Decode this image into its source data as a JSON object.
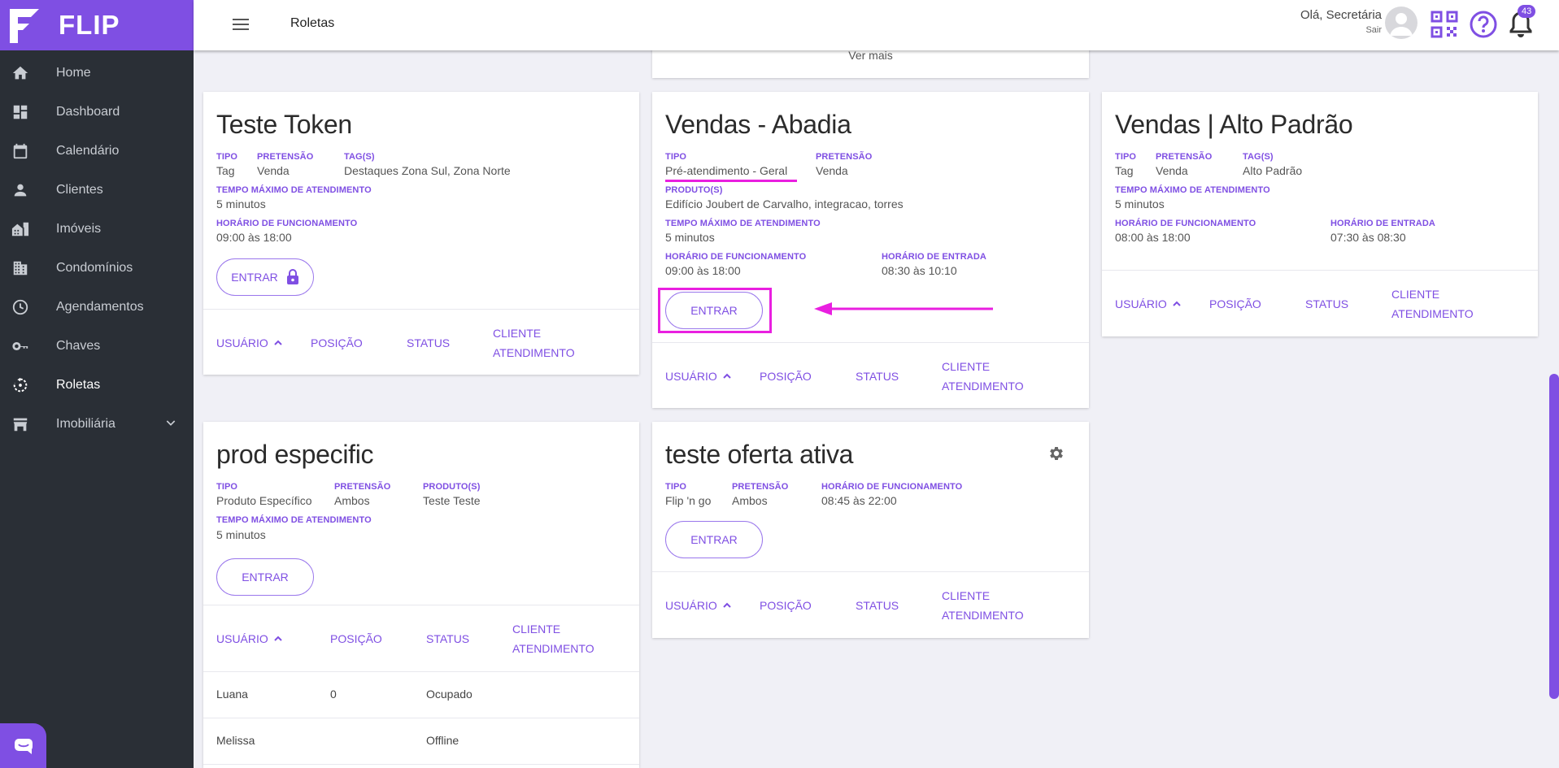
{
  "app": {
    "brand": "FLIP",
    "page_title": "Roletas"
  },
  "user": {
    "greeting": "Olá, Secretária",
    "logout": "Sair",
    "notifications": "43"
  },
  "sidebar": {
    "items": [
      {
        "label": "Home",
        "icon": "home-icon"
      },
      {
        "label": "Dashboard",
        "icon": "dashboard-icon"
      },
      {
        "label": "Calendário",
        "icon": "calendar-icon"
      },
      {
        "label": "Clientes",
        "icon": "person-icon"
      },
      {
        "label": "Imóveis",
        "icon": "building-icon"
      },
      {
        "label": "Condomínios",
        "icon": "apartment-icon"
      },
      {
        "label": "Agendamentos",
        "icon": "clock-icon"
      },
      {
        "label": "Chaves",
        "icon": "key-icon"
      },
      {
        "label": "Roletas",
        "icon": "roulette-icon",
        "active": true
      },
      {
        "label": "Imobiliária",
        "icon": "store-icon",
        "expandable": true
      }
    ]
  },
  "top_card": {
    "see_more": "Ver mais"
  },
  "labels": {
    "tipo": "TIPO",
    "pretensao": "PRETENSÃO",
    "tags": "TAG(S)",
    "produtos": "PRODUTO(S)",
    "tempo": "TEMPO MÁXIMO DE ATENDIMENTO",
    "horario_func": "HORÁRIO DE FUNCIONAMENTO",
    "horario_entrada": "HORÁRIO DE ENTRADA",
    "entrar": "ENTRAR",
    "col_usuario": "USUÁRIO",
    "col_posicao": "POSIÇÃO",
    "col_status": "STATUS",
    "col_cliente_1": "CLIENTE",
    "col_cliente_2": "ATENDIMENTO"
  },
  "cards": {
    "teste_token": {
      "title": "Teste Token",
      "tipo": "Tag",
      "pretensao": "Venda",
      "tags": "Destaques Zona Sul, Zona Norte",
      "tempo": "5 minutos",
      "horario_func": "09:00 às 18:00"
    },
    "vendas_abadia": {
      "title": "Vendas - Abadia",
      "tipo": "Pré-atendimento - Geral",
      "pretensao": "Venda",
      "produtos": "Edifício Joubert de Carvalho, integracao, torres",
      "tempo": "5 minutos",
      "horario_func": "09:00 às 18:00",
      "horario_entrada": "08:30 às 10:10"
    },
    "vendas_alto": {
      "title": "Vendas | Alto Padrão",
      "tipo": "Tag",
      "pretensao": "Venda",
      "tags": "Alto Padrão",
      "tempo": "5 minutos",
      "horario_func": "08:00 às 18:00",
      "horario_entrada": "07:30 às 08:30"
    },
    "prod_especific": {
      "title": "prod especific",
      "tipo": "Produto Específico",
      "pretensao": "Ambos",
      "produtos": "Teste Teste",
      "tempo": "5 minutos",
      "rows": [
        {
          "usuario": "Luana",
          "posicao": "0",
          "status": "Ocupado"
        },
        {
          "usuario": "Melissa",
          "posicao": "",
          "status": "Offline"
        }
      ]
    },
    "teste_oferta": {
      "title": "teste oferta ativa",
      "tipo": "Flip 'n go",
      "pretensao": "Ambos",
      "horario_func": "08:45 às 22:00"
    }
  },
  "colors": {
    "accent": "#7f4fe3",
    "sidebar": "#2a2f36",
    "annotation": "#e91fe0"
  }
}
